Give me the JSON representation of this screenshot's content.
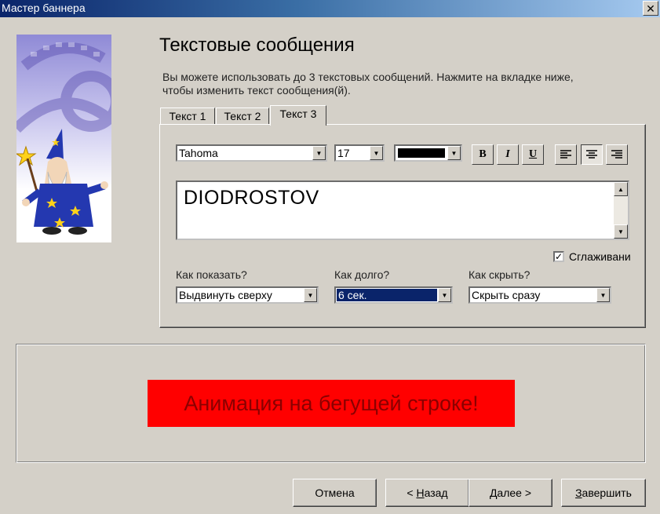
{
  "window": {
    "title": "Мастер баннера"
  },
  "header": {
    "title": "Текстовые сообщения",
    "description_line1": "Вы можете использовать до 3 текстовых сообщений. Нажмите на вкладке ниже,",
    "description_line2": "чтобы изменить текст сообщения(й)."
  },
  "tabs": [
    {
      "label": "Текст 1"
    },
    {
      "label": "Текст 2"
    },
    {
      "label": "Текст 3",
      "active": true
    }
  ],
  "formatting": {
    "font": "Tahoma",
    "size": "17",
    "color": "#000000",
    "bold_label": "B",
    "italic_label": "I",
    "underline_label": "U",
    "alignment": "center"
  },
  "message_text": "DIODROSTOV",
  "smoothing": {
    "label": "Сглаживани",
    "checked": true
  },
  "show": {
    "label": "Как показать?",
    "value": "Выдвинуть сверху"
  },
  "duration": {
    "label": "Как долго?",
    "value": "6 сек."
  },
  "hide": {
    "label": "Как скрыть?",
    "value": "Скрыть сразу"
  },
  "preview": {
    "text": "Анимация на бегущей строке!",
    "bg_color": "#ff0000",
    "text_color": "#8b0000"
  },
  "buttons": {
    "cancel": "Отмена",
    "back_prefix": "< ",
    "back_hotkey": "Н",
    "back_rest": "азад",
    "next": "Далее >",
    "finish_hotkey": "З",
    "finish_rest": "авершить"
  }
}
